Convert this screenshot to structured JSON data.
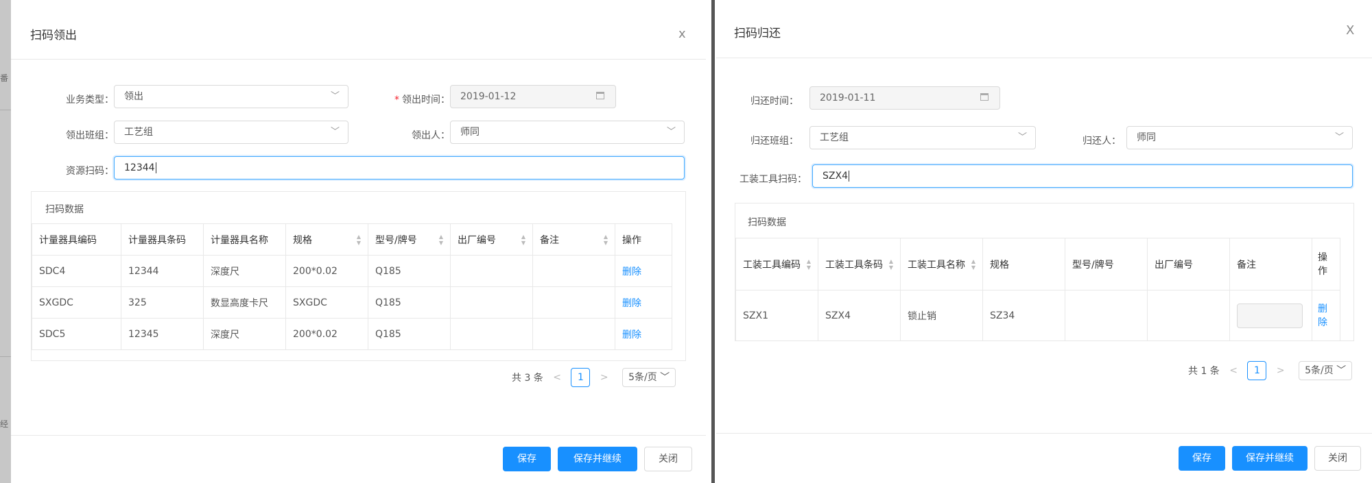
{
  "left": {
    "title": "扫码领出",
    "close_label": "x",
    "form": {
      "biz_type_label": "业务类型：",
      "biz_type_value": "领出",
      "out_time_required": "*",
      "out_time_label": "领出时间：",
      "out_time_value": "2019-01-12",
      "team_label": "领出班组：",
      "team_value": "工艺组",
      "person_label": "领出人：",
      "person_value": "师同",
      "scan_label": "资源扫码：",
      "scan_value": "12344"
    },
    "panel_title": "扫码数据",
    "columns": [
      "计量器具编码",
      "计量器具条码",
      "计量器具名称",
      "规格",
      "型号/牌号",
      "出厂编号",
      "备注",
      "操作"
    ],
    "rows": [
      {
        "code": "SDC4",
        "barcode": "12344",
        "name": "深度尺",
        "spec": "200*0.02",
        "model": "Q185",
        "serial": "",
        "remark": "",
        "action": "删除"
      },
      {
        "code": "SXGDC",
        "barcode": "325",
        "name": "数显高度卡尺",
        "spec": "SXGDC",
        "model": "Q185",
        "serial": "",
        "remark": "",
        "action": "删除"
      },
      {
        "code": "SDC5",
        "barcode": "12345",
        "name": "深度尺",
        "spec": "200*0.02",
        "model": "Q185",
        "serial": "",
        "remark": "",
        "action": "删除"
      }
    ],
    "pager": {
      "total": "共 3 条",
      "prev": "<",
      "page": "1",
      "next": ">",
      "size": "5条/页"
    },
    "buttons": {
      "save": "保存",
      "save_continue": "保存并继续",
      "close": "关闭"
    }
  },
  "right": {
    "title": "扫码归还",
    "close_label": "X",
    "form": {
      "return_time_label": "归还时间：",
      "return_time_value": "2019-01-11",
      "team_label": "归还班组：",
      "team_value": "工艺组",
      "person_label": "归还人：",
      "person_value": "师同",
      "scan_label": "工装工具扫码：",
      "scan_value": "SZX4"
    },
    "panel_title": "扫码数据",
    "columns": [
      "工装工具编码",
      "工装工具条码",
      "工装工具名称",
      "规格",
      "型号/牌号",
      "出厂编号",
      "备注",
      "操作"
    ],
    "rows": [
      {
        "code": "SZX1",
        "barcode": "SZX4",
        "name": "锁止销",
        "spec": "SZ34",
        "model": "",
        "serial": "",
        "remark": "",
        "action": "删除"
      }
    ],
    "pager": {
      "total": "共 1 条",
      "prev": "<",
      "page": "1",
      "next": ">",
      "size": "5条/页"
    },
    "buttons": {
      "save": "保存",
      "save_continue": "保存并继续",
      "close": "关闭"
    }
  },
  "background": {
    "hint_top": "番",
    "hint_bottom": "经"
  }
}
